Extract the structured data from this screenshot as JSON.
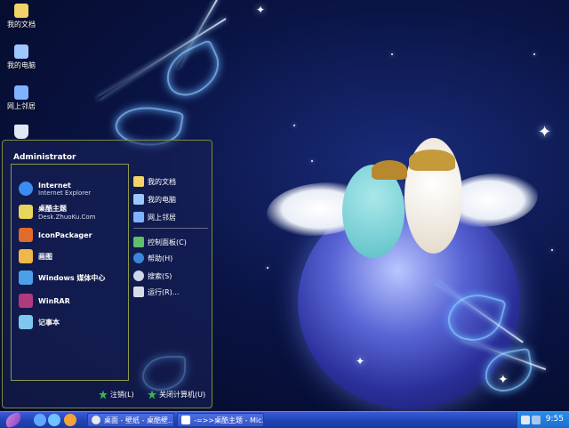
{
  "desktop_icons": [
    {
      "label": "我的文档",
      "icon": "my-documents-icon",
      "color": "#f1d36a"
    },
    {
      "label": "我的电脑",
      "icon": "my-computer-icon",
      "color": "#9fc7ff"
    },
    {
      "label": "网上邻居",
      "icon": "network-places-icon",
      "color": "#7fb2ff"
    },
    {
      "label": "",
      "icon": "recycle-bin-icon",
      "color": "#dfe8f5"
    }
  ],
  "start_menu": {
    "user": "Administrator",
    "left_items": [
      {
        "title": "Internet",
        "subtitle": "Internet Explorer",
        "icon": "internet-explorer-icon",
        "color": "#3c8bef"
      },
      {
        "title": "桌酷主题",
        "subtitle": "Desk.ZhuoKu.Com",
        "icon": "zhuoku-theme-icon",
        "color": "#e7d65a"
      },
      {
        "title": "IconPackager",
        "subtitle": "",
        "icon": "iconpackager-icon",
        "color": "#e06b2b"
      },
      {
        "title": "画图",
        "subtitle": "",
        "icon": "paint-icon",
        "color": "#f0b84a"
      },
      {
        "title": "Windows 媒体中心",
        "subtitle": "",
        "icon": "media-center-icon",
        "color": "#4ba0e8"
      },
      {
        "title": "WinRAR",
        "subtitle": "",
        "icon": "winrar-icon",
        "color": "#b03a7e"
      },
      {
        "title": "记事本",
        "subtitle": "",
        "icon": "notepad-icon",
        "color": "#7ec7f0"
      }
    ],
    "right_items": [
      {
        "label": "我的文档",
        "icon": "my-documents-icon",
        "color": "#f1d36a"
      },
      {
        "label": "我的电脑",
        "icon": "my-computer-icon",
        "color": "#9fc7ff"
      },
      {
        "label": "网上邻居",
        "icon": "network-places-icon",
        "color": "#7fb2ff"
      },
      {
        "label": "控制面板(C)",
        "icon": "control-panel-icon",
        "color": "#5fbf6a"
      },
      {
        "label": "帮助(H)",
        "icon": "help-icon",
        "color": "#3c86d9"
      },
      {
        "label": "搜索(S)",
        "icon": "search-icon",
        "color": "#cfd8e8"
      },
      {
        "label": "运行(R)...",
        "icon": "run-icon",
        "color": "#d6dce8"
      }
    ],
    "footer": {
      "logoff": "注销(L)",
      "shutdown": "关闭计算机(U)"
    }
  },
  "taskbar": {
    "buttons": [
      {
        "label": "桌面 - 壁纸 - 桌酷壁...",
        "icon": "browser-icon",
        "color": "#e8e8e8"
      },
      {
        "label": "-=>>桌酷主题 - Mic...",
        "icon": "document-icon",
        "color": "#ffffff"
      }
    ],
    "quick_launch": [
      {
        "icon": "desktop-icon",
        "color": "#5fa8ff"
      },
      {
        "icon": "ie-icon",
        "color": "#6fc3ff"
      },
      {
        "icon": "media-icon",
        "color": "#f3a33b"
      }
    ],
    "clock": "9:55"
  }
}
